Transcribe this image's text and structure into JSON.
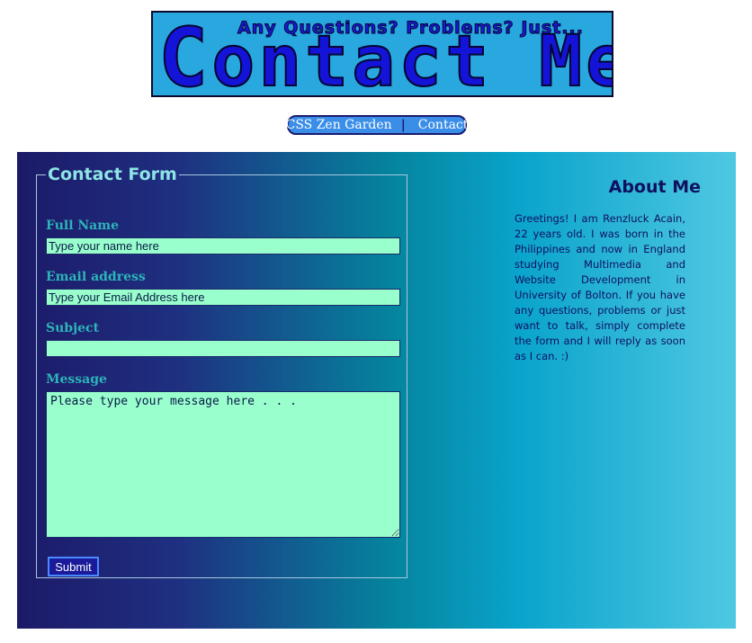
{
  "banner": {
    "tagline": "Any Questions? Problems? Just...",
    "title_first": "C",
    "title_rest": "ontact Me",
    "bg_color": "#29a8e0",
    "text_color": "#1414d8"
  },
  "nav": {
    "items": [
      {
        "label": "CSS Zen Garden"
      },
      {
        "label": "Contact"
      }
    ],
    "separator": "|"
  },
  "form": {
    "legend": "Contact Form",
    "fields": {
      "full_name": {
        "label": "Full Name",
        "placeholder": "Type your name here",
        "value": ""
      },
      "email": {
        "label": "Email address",
        "placeholder": "Type your Email Address here",
        "value": ""
      },
      "subject": {
        "label": "Subject",
        "placeholder": "",
        "value": ""
      },
      "message": {
        "label": "Message",
        "placeholder": "Please type your message here . . .",
        "value": ""
      }
    },
    "submit_label": "Submit"
  },
  "about": {
    "title": "About Me",
    "text": "Greetings! I am Renzluck Acain, 22 years old. I was born in the Philippines and now in England studying Multimedia and Website Development in University of Bolton. If you have any questions, problems or just want to talk, simply complete the form and I will reply as soon as I can. :)"
  },
  "colors": {
    "input_bg": "#99ffcc",
    "label_color": "#2db4b8",
    "legend_color": "#8ee4e4",
    "heading_color": "#101060"
  }
}
